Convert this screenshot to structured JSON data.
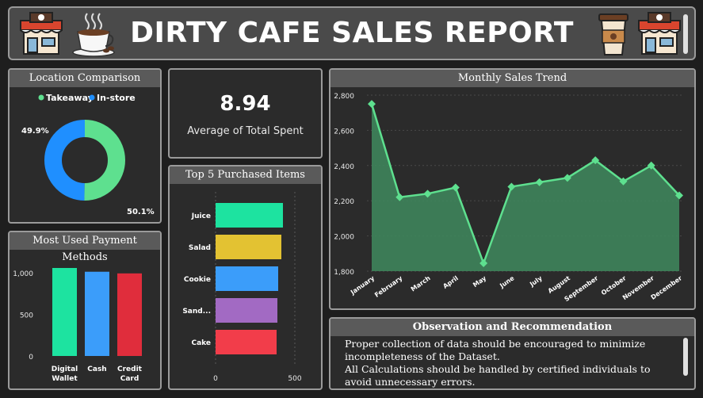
{
  "header": {
    "title": "DIRTY CAFE SALES REPORT"
  },
  "location": {
    "title": "Location Comparison",
    "legend": [
      {
        "label": "Takeaway",
        "color": "#5ee08f"
      },
      {
        "label": "In-store",
        "color": "#1f8fff"
      }
    ],
    "labels": {
      "instore": "49.9%",
      "takeaway": "50.1%"
    }
  },
  "kpi": {
    "value": "8.94",
    "label": "Average of Total Spent"
  },
  "trend": {
    "title": "Monthly Sales Trend",
    "yticks": [
      "2,800",
      "2,600",
      "2,400",
      "2,200",
      "2,000",
      "1,800"
    ],
    "months": [
      "January",
      "February",
      "March",
      "April",
      "May",
      "June",
      "July",
      "August",
      "September",
      "October",
      "November",
      "December"
    ]
  },
  "top5": {
    "title": "Top 5 Purchased Items",
    "items": [
      "Juice",
      "Salad",
      "Cookie",
      "Sand...",
      "Cake"
    ],
    "xticks": [
      "0",
      "500"
    ]
  },
  "payment": {
    "title": "Most Used Payment Methods",
    "yticks": [
      "1,000",
      "500",
      "0"
    ],
    "cats": [
      [
        "Digital",
        "Wallet"
      ],
      [
        "Cash"
      ],
      [
        "Credit",
        "Card"
      ]
    ]
  },
  "obs": {
    "title": "Observation and Recommendation",
    "lines": [
      "Proper collection of data should be encouraged to minimize incompleteness of the Dataset.",
      "All Calculations should be handled by certified individuals to avoid unnecessary errors."
    ]
  },
  "chart_data": [
    {
      "type": "pie",
      "title": "Location Comparison",
      "categories": [
        "Takeaway",
        "In-store"
      ],
      "values": [
        50.1,
        49.9
      ],
      "colors": [
        "#5ee08f",
        "#1f8fff"
      ],
      "legend": "top"
    },
    {
      "type": "area",
      "title": "Monthly Sales Trend",
      "categories": [
        "January",
        "February",
        "March",
        "April",
        "May",
        "June",
        "July",
        "August",
        "September",
        "October",
        "November",
        "December"
      ],
      "values": [
        2750,
        2220,
        2240,
        2275,
        1845,
        2280,
        2305,
        2330,
        2430,
        2310,
        2400,
        2230
      ],
      "ylim": [
        1800,
        2800
      ],
      "color": "#5ee08f"
    },
    {
      "type": "bar",
      "orientation": "horizontal",
      "title": "Top 5 Purchased Items",
      "categories": [
        "Juice",
        "Salad",
        "Cookie",
        "Sandwich",
        "Cake"
      ],
      "values": [
        425,
        415,
        395,
        390,
        385
      ],
      "colors": [
        "#1de3a0",
        "#e3c232",
        "#3b9dfa",
        "#a26ac3",
        "#f23d4a"
      ],
      "xlim": [
        0,
        600
      ]
    },
    {
      "type": "bar",
      "title": "Most Used Payment Methods",
      "categories": [
        "Digital Wallet",
        "Cash",
        "Credit Card"
      ],
      "values": [
        1055,
        1010,
        990
      ],
      "colors": [
        "#1de3a0",
        "#3b9dfa",
        "#e02d3c"
      ],
      "ylim": [
        0,
        1150
      ]
    }
  ]
}
